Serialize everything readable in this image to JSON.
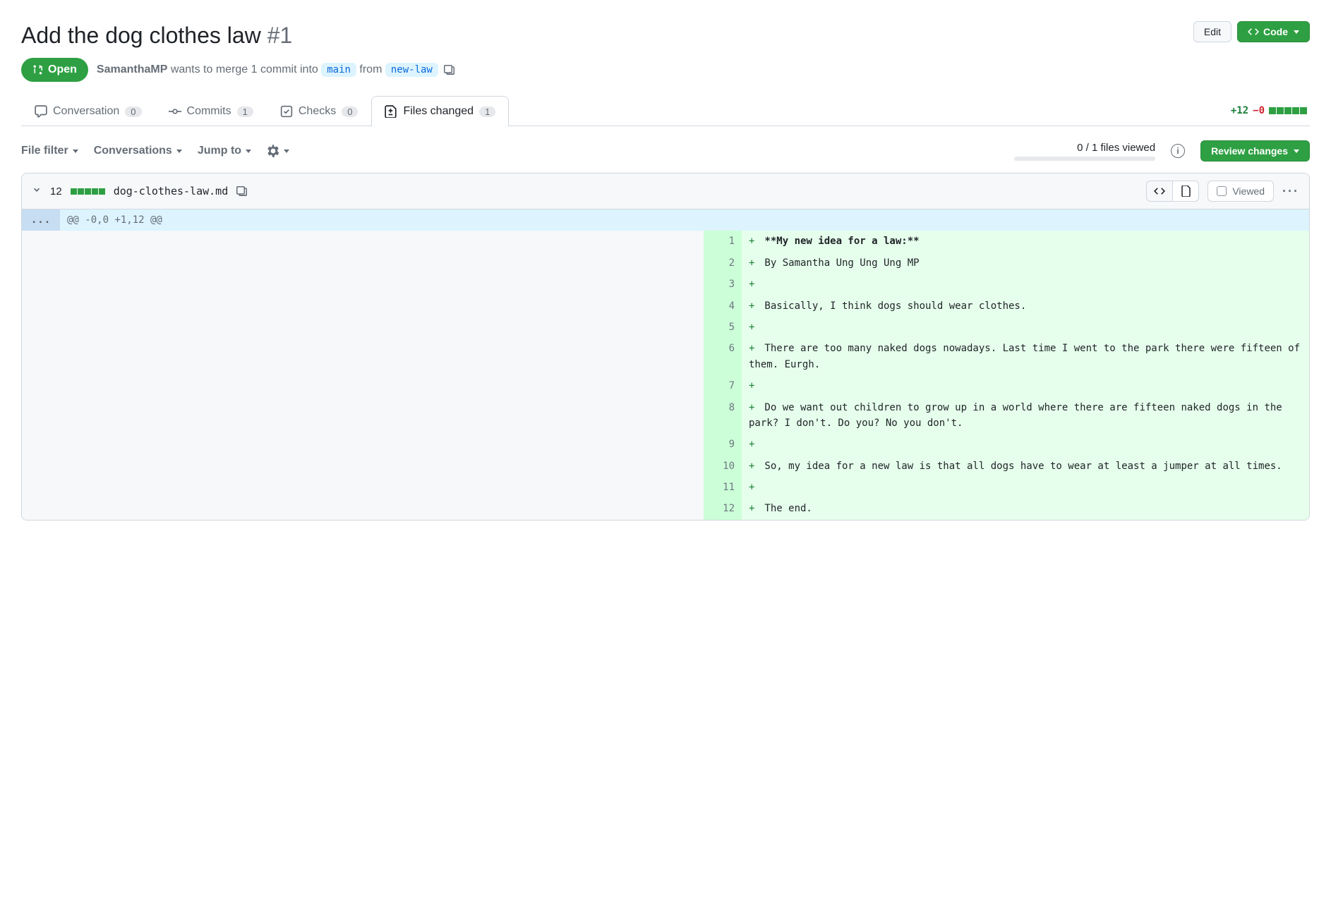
{
  "header": {
    "title": "Add the dog clothes law",
    "issue_number": "#1",
    "edit_label": "Edit",
    "code_label": "Code"
  },
  "state": {
    "badge": "Open",
    "author": "SamanthaMP",
    "merge_text_1": "wants to merge 1 commit into",
    "base_branch": "main",
    "from_text": "from",
    "head_branch": "new-law"
  },
  "tabs": {
    "conversation": {
      "label": "Conversation",
      "count": "0"
    },
    "commits": {
      "label": "Commits",
      "count": "1"
    },
    "checks": {
      "label": "Checks",
      "count": "0"
    },
    "files": {
      "label": "Files changed",
      "count": "1"
    }
  },
  "diffstat": {
    "additions": "+12",
    "deletions": "−0"
  },
  "toolbar": {
    "file_filter": "File filter",
    "conversations": "Conversations",
    "jump_to": "Jump to",
    "files_viewed": "0 / 1 files viewed",
    "review_changes": "Review changes"
  },
  "file": {
    "change_count": "12",
    "name": "dog-clothes-law.md",
    "viewed_label": "Viewed",
    "hunk_header": "@@ -0,0 +1,12 @@",
    "expand_marker": "..."
  },
  "diff_lines": [
    {
      "num": "1",
      "text": "**My new idea for a law:**",
      "bold": true
    },
    {
      "num": "2",
      "text": "By Samantha Ung Ung Ung MP"
    },
    {
      "num": "3",
      "text": ""
    },
    {
      "num": "4",
      "text": "Basically, I think dogs should wear clothes."
    },
    {
      "num": "5",
      "text": ""
    },
    {
      "num": "6",
      "text": "There are too many naked dogs nowadays. Last time I went to the park there were fifteen of them. Eurgh."
    },
    {
      "num": "7",
      "text": ""
    },
    {
      "num": "8",
      "text": "Do we want out children to grow up in a world where there are fifteen naked dogs in the park? I don't. Do you? No you don't."
    },
    {
      "num": "9",
      "text": ""
    },
    {
      "num": "10",
      "text": "So, my idea for a new law is that all dogs have to wear at least a jumper at all times."
    },
    {
      "num": "11",
      "text": ""
    },
    {
      "num": "12",
      "text": "The end."
    }
  ]
}
